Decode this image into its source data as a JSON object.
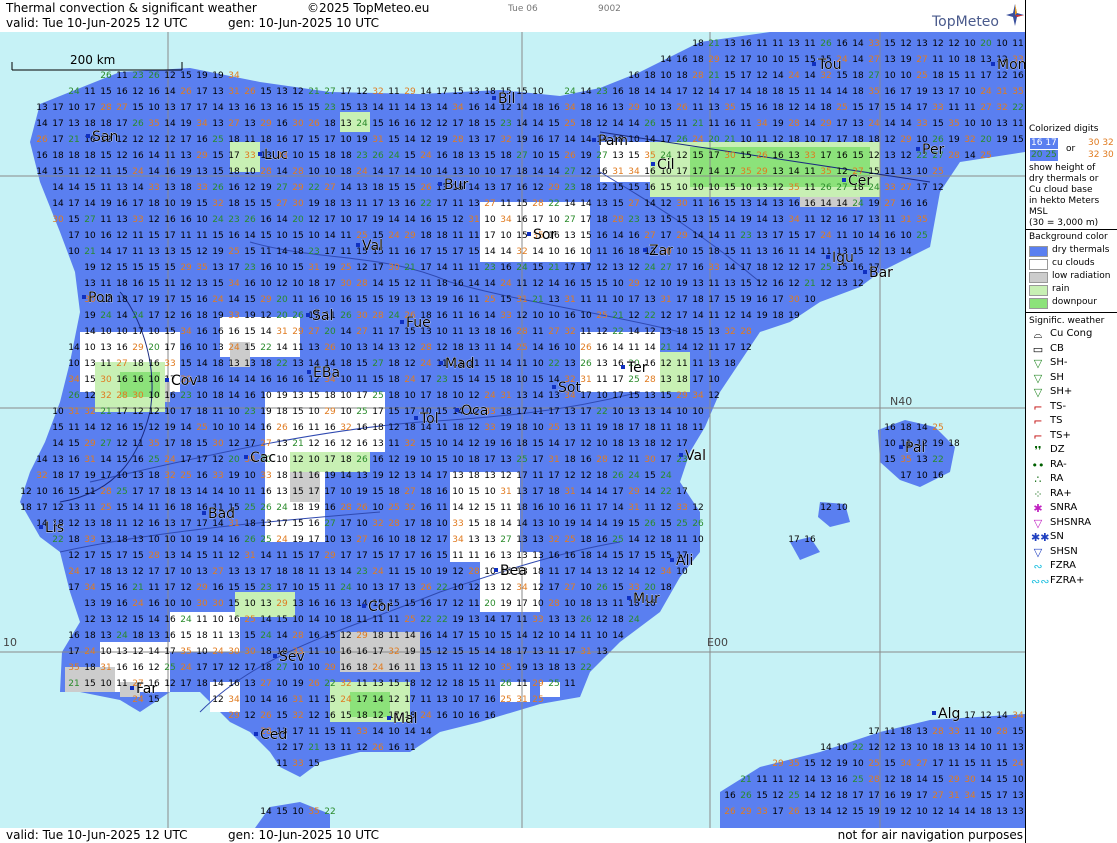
{
  "header": {
    "title": "Thermal convection & significant weather",
    "copyright": "©2025 TopMeteo.eu",
    "valid": "valid:  Tue  10-Jun-2025  12 UTC",
    "gen": "gen: 10-Jun-2025 10 UTC",
    "day": "Tue 06",
    "code": "9002",
    "logo": "TopMeteo"
  },
  "footer": {
    "valid": "valid:  Tue  10-Jun-2025  12 UTC",
    "gen": "gen: 10-Jun-2025 10 UTC",
    "note": "not for air navigation purposes"
  },
  "map": {
    "scale_label": "200 km",
    "grid_labels": {
      "lat": "N40",
      "lon_e00": "E00",
      "lon_w10": "10"
    },
    "cities": [
      "San",
      "Luc",
      "Bil",
      "Pam",
      "Tou",
      "Mon",
      "Per",
      "Cil",
      "Cer",
      "Bur",
      "Sor",
      "Zar",
      "Igu",
      "Bar",
      "Val",
      "Pon",
      "Sal",
      "Fue",
      "Mad",
      "Cov",
      "EBa",
      "Sot",
      "Ter",
      "Tol",
      "Oca",
      "Cac",
      "Val",
      "Pal",
      "Lis",
      "Bad",
      "Ali",
      "Bea",
      "Mur",
      "Cor",
      "Sev",
      "Far",
      "Alg",
      "Ced",
      "Mal"
    ],
    "colors": {
      "sea": "#c6f2f6",
      "dry": "#5a7ff0",
      "cu": "#ffffff",
      "lowrad": "#cccccc",
      "rain": "#c8f0b4",
      "downpour": "#8ce27a"
    }
  },
  "legend": {
    "colorized_title": [
      "Colorized digits"
    ],
    "digits_or": "or",
    "digit_samples": {
      "dry": "16 17",
      "dry2": "20 25",
      "cu": "30 32",
      "cu2": "32 30"
    },
    "colorized_desc": [
      "show height of",
      "dry thermals or",
      "Cu cloud base",
      "in hekto Meters",
      "MSL",
      "(30 = 3,000 m)"
    ],
    "bg_title": "Background color",
    "bg_items": [
      {
        "label": "dry thermals",
        "color": "#5a7ff0"
      },
      {
        "label": "cu clouds",
        "color": "#ffffff"
      },
      {
        "label": "low radiation",
        "color": "#cccccc"
      },
      {
        "label": "rain",
        "color": "#c8f0b4"
      },
      {
        "label": "downpour",
        "color": "#8ce27a"
      }
    ],
    "wx_title": "Signific. weather",
    "wx_items": [
      {
        "label": "Cu Cong",
        "icon": "cu-cong-icon",
        "glyph": "⌓",
        "color": "#000000"
      },
      {
        "label": "CB",
        "icon": "cb-icon",
        "glyph": "▭",
        "color": "#000000"
      },
      {
        "label": "SH-",
        "icon": "shower-light-icon",
        "glyph": "▽",
        "color": "#2a8a2a"
      },
      {
        "label": "SH",
        "icon": "shower-icon",
        "glyph": "▽",
        "color": "#2a8a2a"
      },
      {
        "label": "SH+",
        "icon": "shower-heavy-icon",
        "glyph": "▽",
        "color": "#2a8a2a"
      },
      {
        "label": "TS-",
        "icon": "thunder-light-icon",
        "glyph": "⌐",
        "color": "#c00000"
      },
      {
        "label": "TS",
        "icon": "thunder-icon",
        "glyph": "⌐",
        "color": "#c00000"
      },
      {
        "label": "TS+",
        "icon": "thunder-heavy-icon",
        "glyph": "⌐",
        "color": "#c00000"
      },
      {
        "label": "DZ",
        "icon": "drizzle-icon",
        "glyph": "❜❜",
        "color": "#006000"
      },
      {
        "label": "RA-",
        "icon": "rain-light-icon",
        "glyph": "••",
        "color": "#006000"
      },
      {
        "label": "RA",
        "icon": "rain-icon",
        "glyph": "∴",
        "color": "#006000"
      },
      {
        "label": "RA+",
        "icon": "rain-heavy-icon",
        "glyph": "⁘",
        "color": "#006000"
      },
      {
        "label": "SNRA",
        "icon": "snow-rain-icon",
        "glyph": "✱",
        "color": "#c020c0"
      },
      {
        "label": "SHSNRA",
        "icon": "snow-rain-shower-icon",
        "glyph": "▽",
        "color": "#c020c0"
      },
      {
        "label": "SN",
        "icon": "snow-icon",
        "glyph": "✱✱",
        "color": "#2040c0"
      },
      {
        "label": "SHSN",
        "icon": "snow-shower-icon",
        "glyph": "▽",
        "color": "#2040c0"
      },
      {
        "label": "FZRA",
        "icon": "freezing-rain-icon",
        "glyph": "∾",
        "color": "#20c0e0"
      },
      {
        "label": "FZRA+",
        "icon": "freezing-rain-heavy-icon",
        "glyph": "∾∾",
        "color": "#20c0e0"
      }
    ]
  }
}
